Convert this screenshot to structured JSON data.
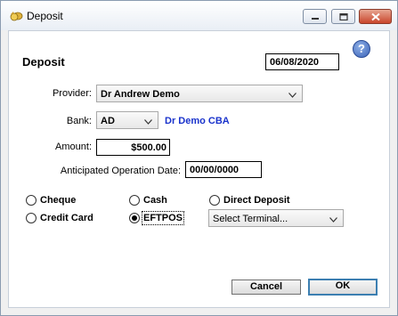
{
  "window": {
    "title": "Deposit"
  },
  "form": {
    "heading": "Deposit",
    "date": "06/08/2020",
    "help_label": "?",
    "provider": {
      "label": "Provider:",
      "value": "Dr Andrew Demo"
    },
    "bank": {
      "label": "Bank:",
      "value": "AD",
      "name": "Dr Demo CBA"
    },
    "amount": {
      "label": "Amount:",
      "value": "$500.00"
    },
    "anticipated": {
      "label": "Anticipated Operation Date:",
      "value": "00/00/0000"
    },
    "payment_methods": {
      "cheque": "Cheque",
      "cash": "Cash",
      "direct_deposit": "Direct Deposit",
      "credit_card": "Credit Card",
      "eftpos": "EFTPOS",
      "selected": "EFTPOS"
    },
    "terminal": {
      "value": "Select Terminal..."
    }
  },
  "buttons": {
    "cancel": "Cancel",
    "ok": "OK"
  }
}
